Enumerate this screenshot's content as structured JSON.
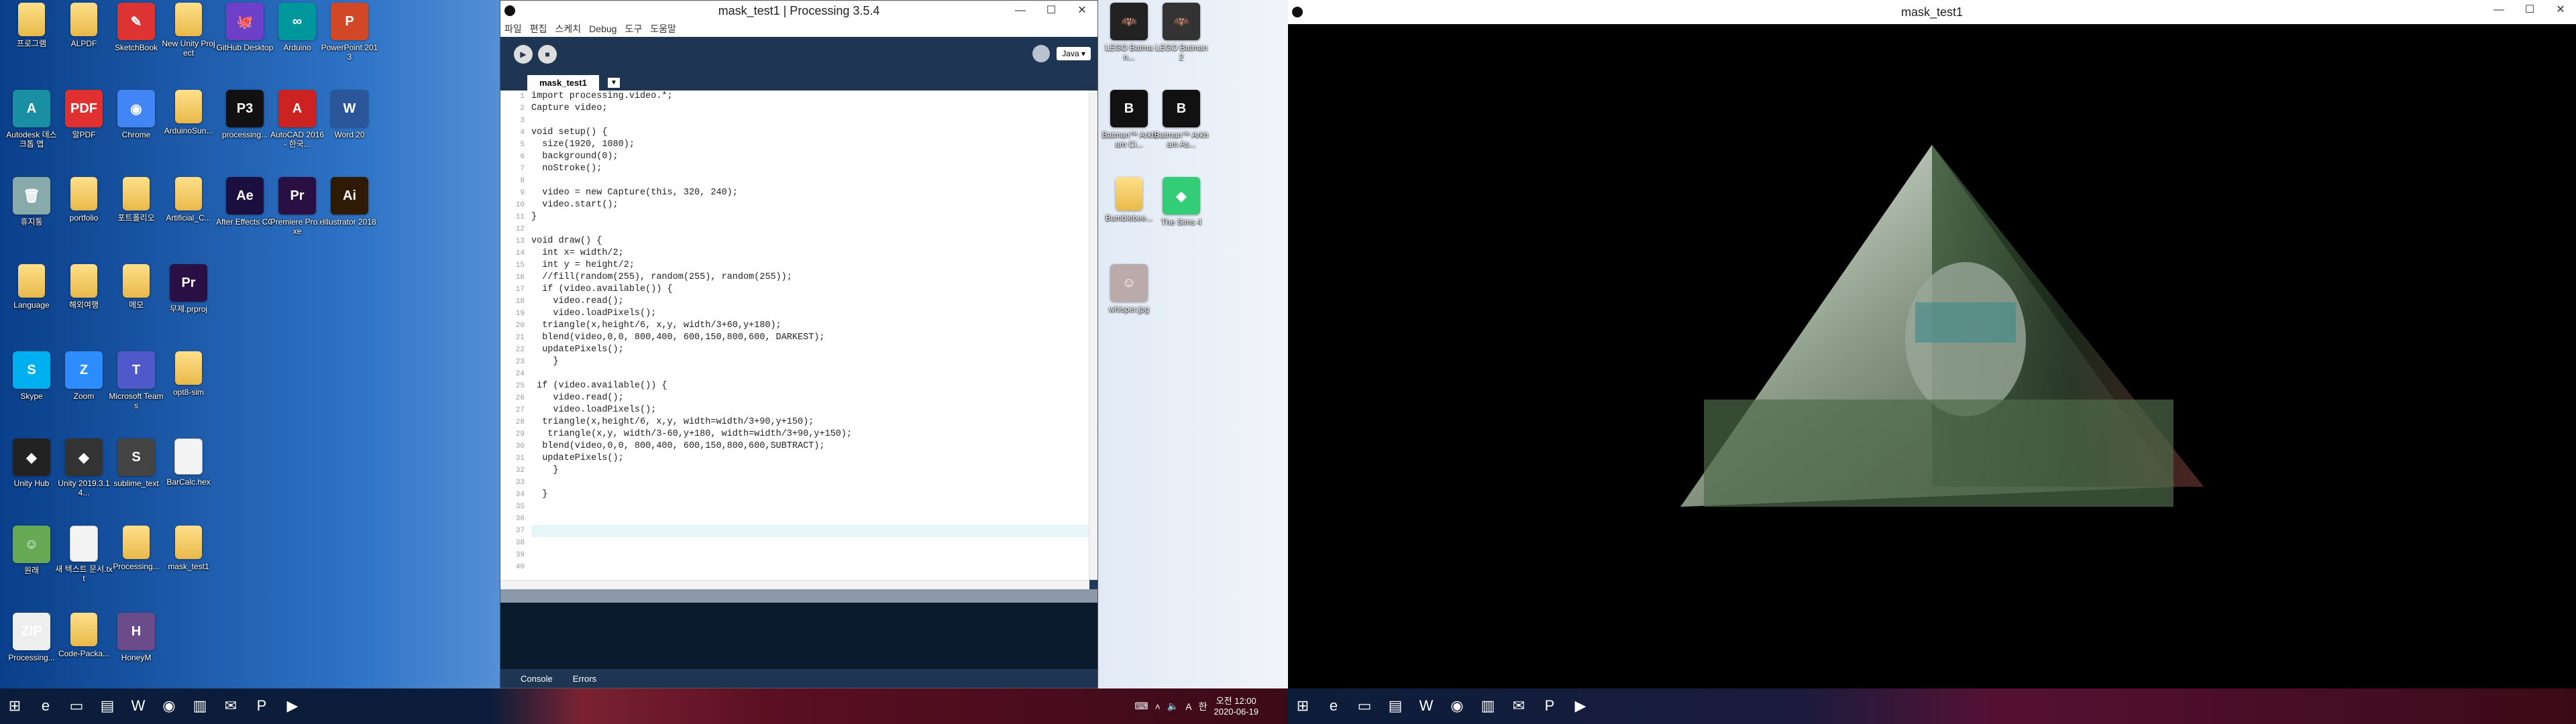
{
  "desktop": {
    "icons": [
      {
        "label": "프로그램",
        "kind": "folder"
      },
      {
        "label": "ALPDF",
        "kind": "folder"
      },
      {
        "label": "SketchBook",
        "kind": "app",
        "color": "#d33",
        "glyph": "✎"
      },
      {
        "label": "New Unity Project",
        "kind": "folder"
      },
      {
        "label": "Autodesk 데스크톱 앱",
        "kind": "app",
        "color": "#1a8ea3",
        "glyph": "A"
      },
      {
        "label": "알PDF",
        "kind": "app",
        "color": "#e03030",
        "glyph": "PDF"
      },
      {
        "label": "Chrome",
        "kind": "app",
        "color": "#4285f4",
        "glyph": "◉"
      },
      {
        "label": "ArduinoSun...",
        "kind": "folder"
      },
      {
        "label": "휴지통",
        "kind": "app",
        "color": "#8aa",
        "glyph": "🗑"
      },
      {
        "label": "portfolio",
        "kind": "folder"
      },
      {
        "label": "포트폴리오",
        "kind": "folder"
      },
      {
        "label": "Artificial_C...",
        "kind": "folder"
      },
      {
        "label": "Language",
        "kind": "folder"
      },
      {
        "label": "해외여행",
        "kind": "folder"
      },
      {
        "label": "메모",
        "kind": "folder"
      },
      {
        "label": "무제.prproj",
        "kind": "app",
        "color": "#2a0f44",
        "glyph": "Pr"
      },
      {
        "label": "Skype",
        "kind": "app",
        "color": "#00aff0",
        "glyph": "S"
      },
      {
        "label": "Zoom",
        "kind": "app",
        "color": "#2d8cff",
        "glyph": "Z"
      },
      {
        "label": "Microsoft Teams",
        "kind": "app",
        "color": "#5059c9",
        "glyph": "T"
      },
      {
        "label": "opt8-sim",
        "kind": "folder"
      },
      {
        "label": "Unity Hub",
        "kind": "app",
        "color": "#222",
        "glyph": "◆"
      },
      {
        "label": "Unity 2019.3.14...",
        "kind": "app",
        "color": "#333",
        "glyph": "◆"
      },
      {
        "label": "sublime_text",
        "kind": "app",
        "color": "#444",
        "glyph": "S"
      },
      {
        "label": "BarCalc.hex",
        "kind": "file"
      },
      {
        "label": "원래",
        "kind": "app",
        "color": "#6a5",
        "glyph": "☺"
      },
      {
        "label": "새 텍스트 문서.txt",
        "kind": "file"
      },
      {
        "label": "Processing...",
        "kind": "folder"
      },
      {
        "label": "mask_test1",
        "kind": "folder"
      },
      {
        "label": "Processing...",
        "kind": "app",
        "color": "#eee",
        "glyph": "ZIP"
      },
      {
        "label": "Code-Packa...",
        "kind": "folder"
      },
      {
        "label": "HoneyM",
        "kind": "app",
        "color": "#6c4b8b",
        "glyph": "H"
      }
    ],
    "icons_col2": [
      {
        "label": "GitHub Desktop",
        "kind": "app",
        "color": "#6e40c9",
        "glyph": "🐙"
      },
      {
        "label": "Arduino",
        "kind": "app",
        "color": "#00979c",
        "glyph": "∞"
      },
      {
        "label": "PowerPoint 2013",
        "kind": "app",
        "color": "#d24726",
        "glyph": "P"
      },
      {
        "label": "processing...",
        "kind": "app",
        "color": "#111",
        "glyph": "P3"
      },
      {
        "label": "AutoCAD 2016 - 한국...",
        "kind": "app",
        "color": "#c22",
        "glyph": "A"
      },
      {
        "label": "Word 20",
        "kind": "app",
        "color": "#2b579a",
        "glyph": "W"
      },
      {
        "label": "After Effects CC",
        "kind": "app",
        "color": "#1a0f3e",
        "glyph": "Ae"
      },
      {
        "label": "Premiere Pro.exe",
        "kind": "app",
        "color": "#2a0f44",
        "glyph": "Pr"
      },
      {
        "label": "Illustrator 2018",
        "kind": "app",
        "color": "#2e1a05",
        "glyph": "Ai"
      }
    ],
    "icons_col3": [
      {
        "label": "LEGO Batman...",
        "kind": "app",
        "color": "#222",
        "glyph": "🦇"
      },
      {
        "label": "LEGO Batman 2",
        "kind": "app",
        "color": "#333",
        "glyph": "🦇"
      },
      {
        "label": "Batman™ Arkham Ci...",
        "kind": "app",
        "color": "#111",
        "glyph": "B"
      },
      {
        "label": "Batman™ Arkham As...",
        "kind": "app",
        "color": "#111",
        "glyph": "B"
      },
      {
        "label": "Bumblebee...",
        "kind": "folder"
      },
      {
        "label": "The Sims 4",
        "kind": "app",
        "color": "#3c7",
        "glyph": "◆"
      },
      {
        "label": "whisper.jpg",
        "kind": "app",
        "color": "#baa",
        "glyph": "☺"
      }
    ]
  },
  "processing_window": {
    "title": "mask_test1 | Processing 3.5.4",
    "menu": [
      "파일",
      "편집",
      "스케치",
      "Debug",
      "도구",
      "도움말"
    ],
    "mode": "Java",
    "tab": "mask_test1",
    "code_lines": [
      "import processing.video.*;",
      "Capture video;",
      "",
      "void setup() {",
      "  size(1920, 1080);",
      "  background(0);",
      "  noStroke();",
      "",
      "  video = new Capture(this, 320, 240);",
      "  video.start();",
      "}",
      "",
      "void draw() {",
      "  int x= width/2;",
      "  int y = height/2;",
      "  //fill(random(255), random(255), random(255));",
      "  if (video.available()) {",
      "    video.read();",
      "    video.loadPixels();",
      "  triangle(x,height/6, x,y, width/3+60,y+180);",
      "  blend(video,0,0, 800,400, 600,150,800,600, DARKEST);",
      "  updatePixels();",
      "    }",
      "",
      " if (video.available()) {",
      "    video.read();",
      "    video.loadPixels();",
      "  triangle(x,height/6, x,y, width=width/3+90,y+150);",
      "   triangle(x,y, width/3-60,y+180, width=width/3+90,y+150);",
      "  blend(video,0,0, 800,400, 600,150,800,600,SUBTRACT);",
      "  updatePixels();",
      "    }",
      "",
      "  }",
      "",
      "",
      "",
      "",
      "",
      ""
    ],
    "console_tab": "Console",
    "errors_tab": "Errors"
  },
  "mask_window": {
    "title": "mask_test1"
  },
  "taskbar": {
    "clock_time": "오전 12:00",
    "clock_date": "2020-06-19",
    "ime": "A",
    "lang": "한"
  }
}
